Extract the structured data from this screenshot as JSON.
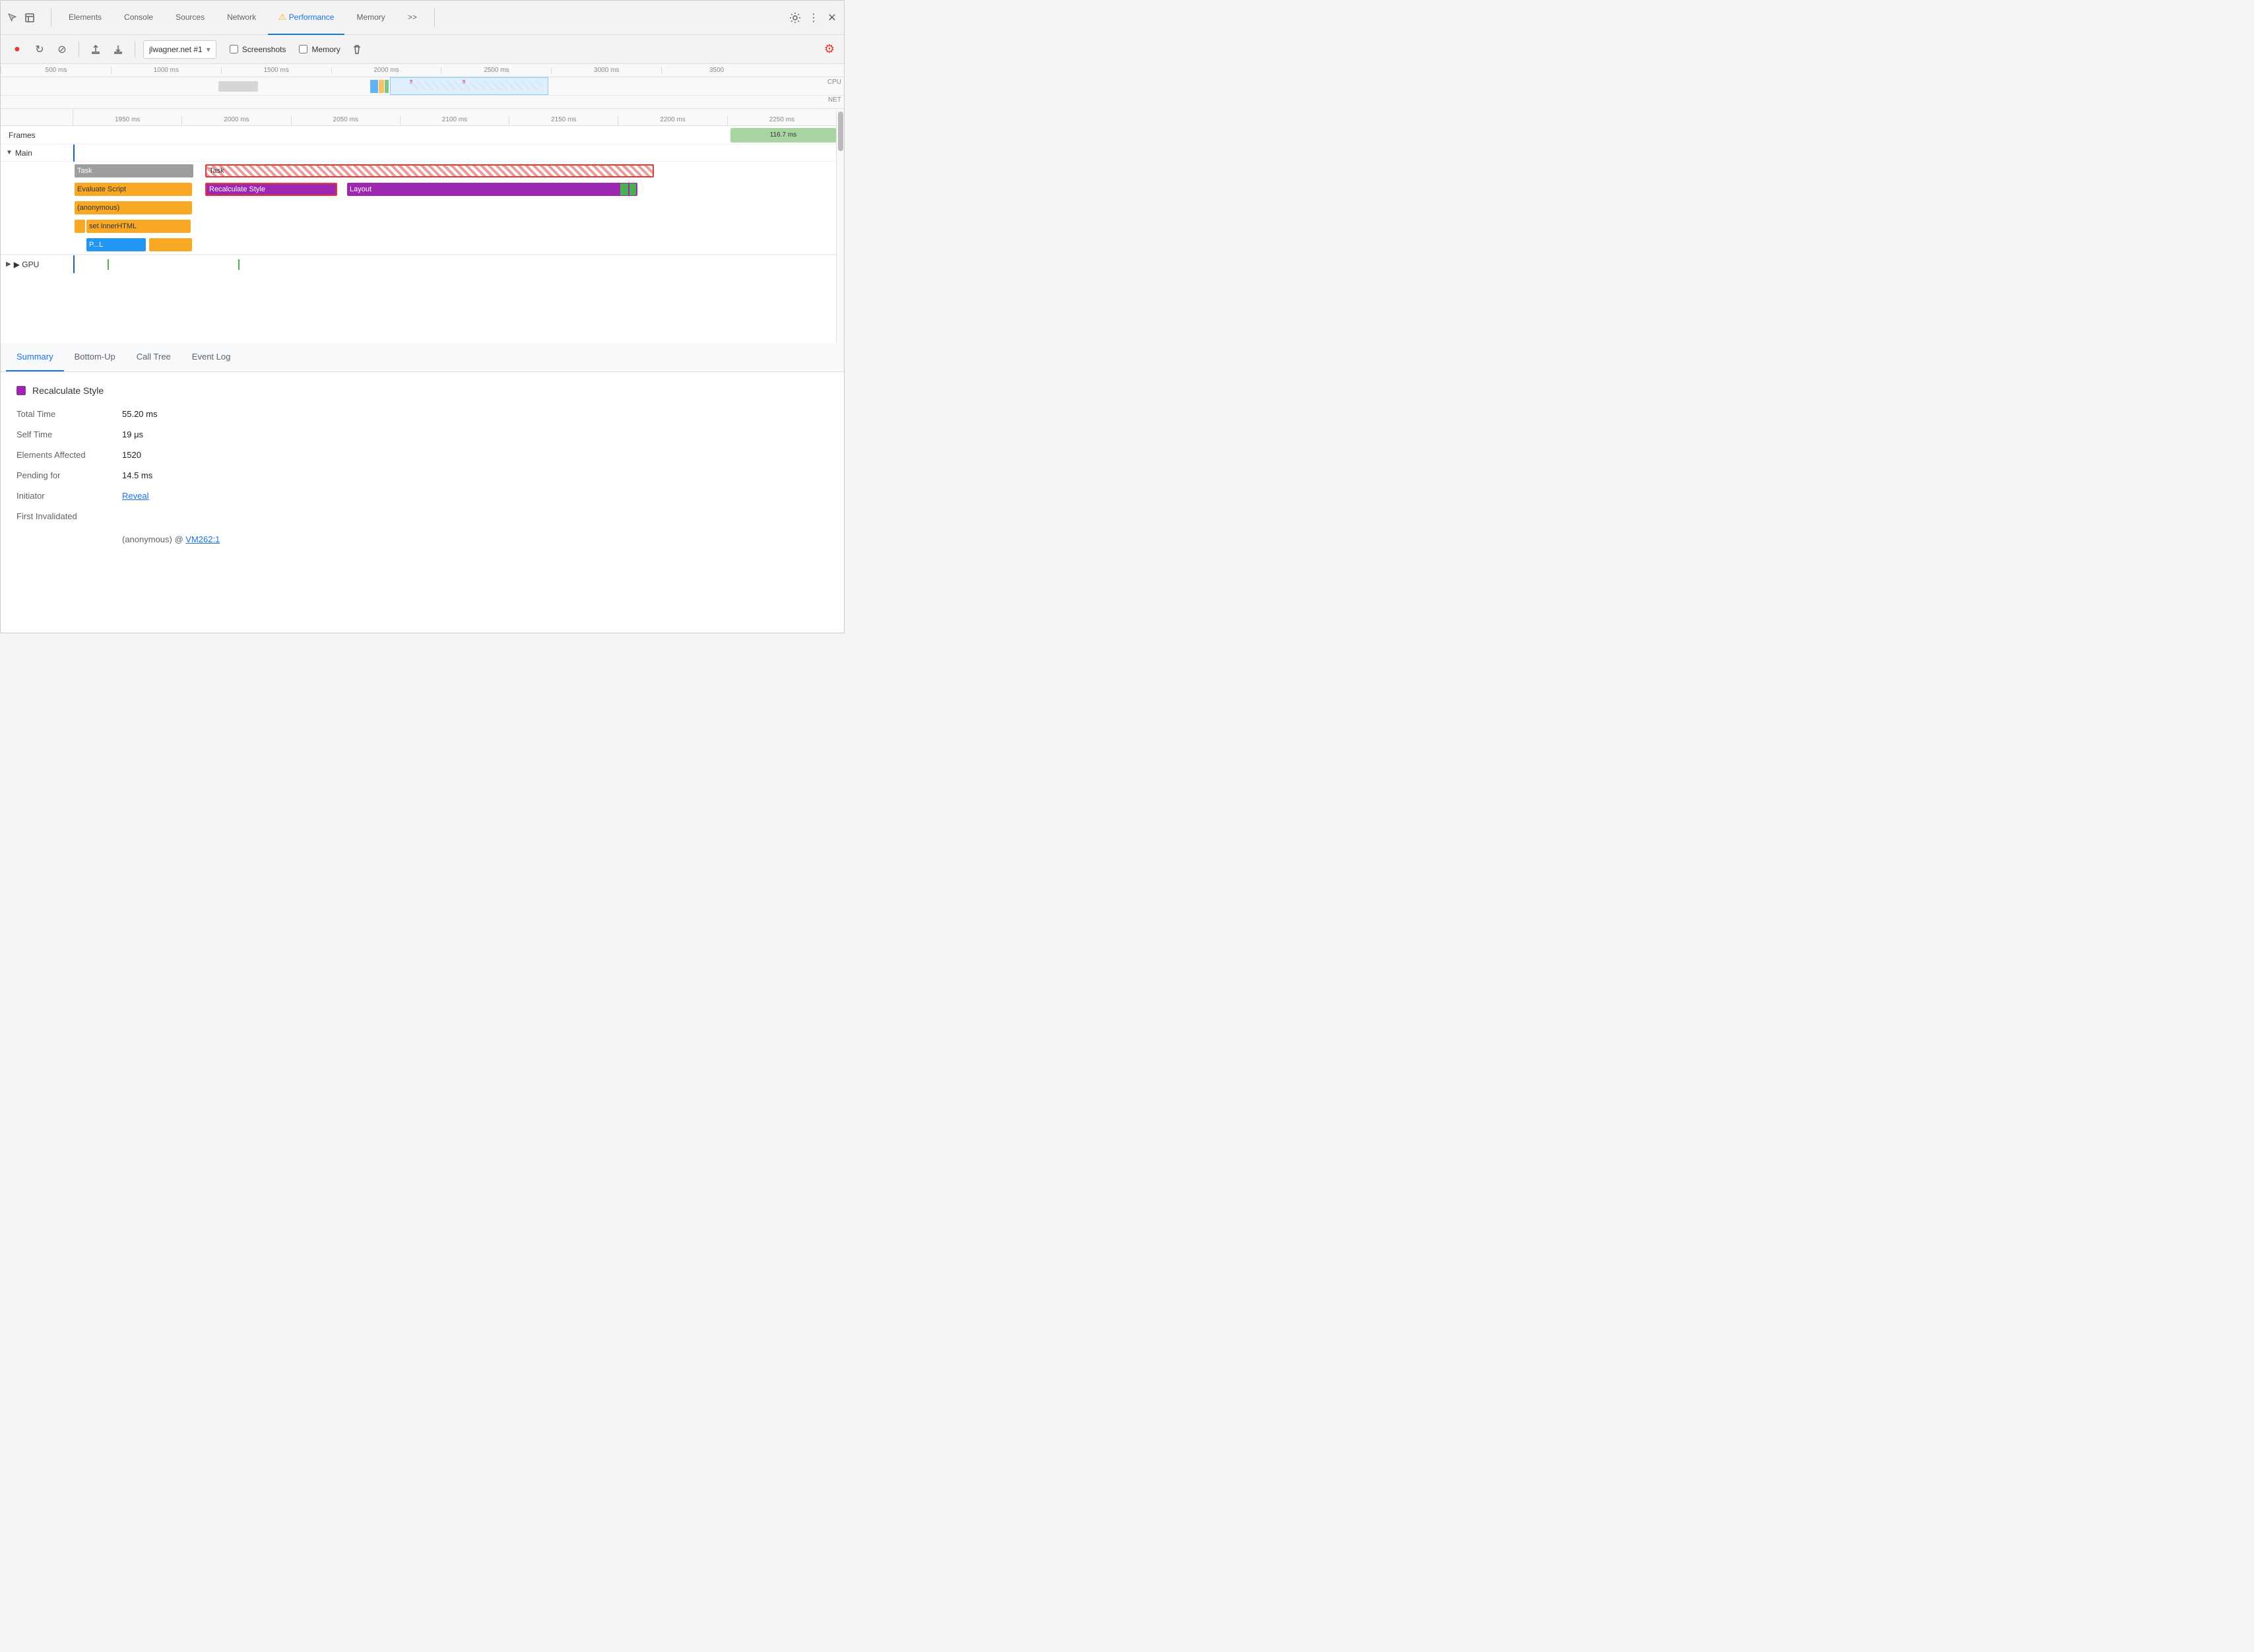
{
  "devtools": {
    "tabs": [
      {
        "id": "elements",
        "label": "Elements",
        "active": false
      },
      {
        "id": "console",
        "label": "Console",
        "active": false
      },
      {
        "id": "sources",
        "label": "Sources",
        "active": false
      },
      {
        "id": "network",
        "label": "Network",
        "active": false
      },
      {
        "id": "performance",
        "label": "Performance",
        "active": true,
        "warn": true
      },
      {
        "id": "memory",
        "label": "Memory",
        "active": false
      }
    ],
    "more_tabs_label": ">>",
    "settings_title": "Settings",
    "more_options_title": "More options",
    "close_title": "Close"
  },
  "toolbar": {
    "record_label": "●",
    "reload_label": "↻",
    "clear_label": "⊘",
    "upload_label": "↑",
    "download_label": "↓",
    "url_value": "jlwagner.net #1",
    "url_chevron": "▾",
    "screenshots_label": "Screenshots",
    "memory_label": "Memory",
    "trash_label": "🗑",
    "settings_label": "⚙"
  },
  "minimap": {
    "ticks": [
      "500 ms",
      "1000 ms",
      "1500 ms",
      "2000 ms",
      "2500 ms",
      "3000 ms",
      "3500"
    ],
    "cpu_label": "CPU",
    "net_label": "NET"
  },
  "timeline": {
    "ruler_ticks": [
      "1950 ms",
      "2000 ms",
      "2050 ms",
      "2100 ms",
      "2150 ms",
      "2200 ms",
      "2250 ms"
    ],
    "frames_label": "Frames",
    "frame_value": "116.7 ms",
    "main_label": "▼ Main",
    "gpu_label": "▶ GPU"
  },
  "tasks": {
    "task1_label": "Task",
    "task2_label": "Task",
    "evaluate_script_label": "Evaluate Script",
    "recalculate_style_label": "Recalculate Style",
    "layout_label": "Layout",
    "anonymous_label": "(anonymous)",
    "set_inner_html_label": "set innerHTML",
    "p_l_label": "P...L"
  },
  "bottom_tabs": [
    {
      "id": "summary",
      "label": "Summary",
      "active": true
    },
    {
      "id": "bottom-up",
      "label": "Bottom-Up",
      "active": false
    },
    {
      "id": "call-tree",
      "label": "Call Tree",
      "active": false
    },
    {
      "id": "event-log",
      "label": "Event Log",
      "active": false
    }
  ],
  "summary": {
    "title": "Recalculate Style",
    "color": "#9c27b0",
    "fields": [
      {
        "key": "Total Time",
        "value": "55.20 ms"
      },
      {
        "key": "Self Time",
        "value": "19 μs"
      },
      {
        "key": "Elements Affected",
        "value": "1520"
      },
      {
        "key": "Pending for",
        "value": "14.5 ms"
      },
      {
        "key": "Initiator",
        "value": "Reveal",
        "is_link": true
      },
      {
        "key": "First Invalidated",
        "value": ""
      },
      {
        "key": "",
        "value": "(anonymous) @ VM262:1",
        "is_sub": true,
        "link_part": "VM262:1"
      }
    ]
  }
}
